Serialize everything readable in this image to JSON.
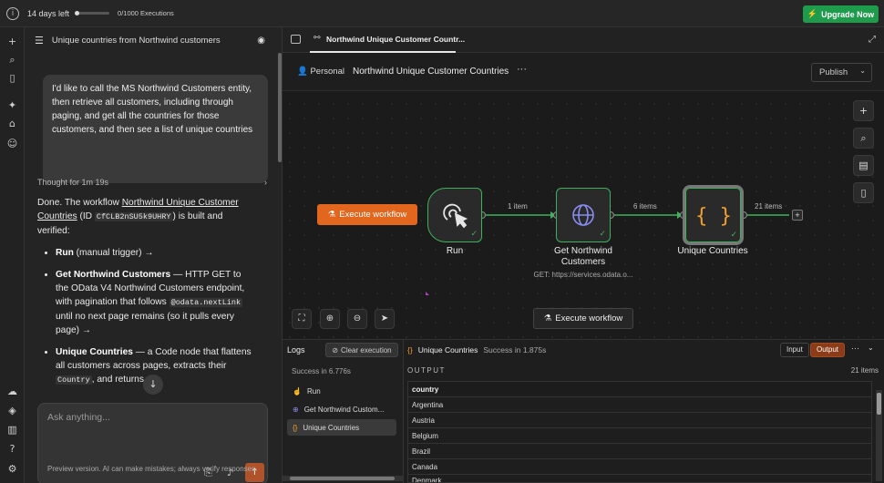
{
  "topbar": {
    "trial": "14 days left",
    "executions": "0/1000 Executions",
    "upgrade": "Upgrade Now",
    "upgrade_icon": "⚡"
  },
  "chat": {
    "title": "Unique countries from Northwind customers",
    "user_message": "I'd like to call the MS Northwind Customers entity, then retrieve all customers, including through paging, and get all the countries for those customers, and then see a list of unique countries",
    "thought": "Thought for 1m 19s",
    "reply_intro_1": "Done. The workflow ",
    "reply_link": "Northwind Unique Customer Countries",
    "reply_intro_2": " (ID ",
    "reply_id": "CfCLB2nSU5k9UHRY",
    "reply_intro_3": ") is built and verified:",
    "bullet1_bold": "Run",
    "bullet1_rest": " (manual trigger) →",
    "bullet2_bold": "Get Northwind Customers",
    "bullet2_rest": " — HTTP GET to the OData V4 Northwind Customers endpoint, with pagination that follows ",
    "bullet2_code": "@odata.nextLink",
    "bullet2_rest2": " until no next page remains (so it pulls every page) →",
    "bullet3_bold": "Unique Countries",
    "bullet3_rest": " — a Code node that flattens all customers across pages, extracts their ",
    "bullet3_code": "Country",
    "bullet3_rest2": ", and returns a",
    "input_placeholder": "Ask anything...",
    "disclaimer": "Preview version. AI can make mistakes; always verify responses."
  },
  "tab": {
    "label": "Northwind Unique Customer Countr..."
  },
  "workflow": {
    "owner": "Personal",
    "name": "Northwind Unique Customer Countries",
    "publish": "Publish",
    "execute": "Execute workflow"
  },
  "nodes": {
    "run": {
      "label": "Run"
    },
    "http": {
      "label1": "Get Northwind",
      "label2": "Customers",
      "sub": "GET: https://services.odata.o..."
    },
    "code": {
      "label": "Unique Countries"
    }
  },
  "edges": {
    "e1": "1 item",
    "e2": "6 items",
    "e3": "21 items"
  },
  "logs": {
    "title": "Logs",
    "clear": "Clear execution",
    "success": "Success in 6.776s",
    "items": [
      "Run",
      "Get Northwind Custom...",
      "Unique Countries"
    ]
  },
  "output": {
    "node": "Unique Countries",
    "status": "Success in 1.875s",
    "input_tab": "Input",
    "output_tab": "Output",
    "label": "OUTPUT",
    "count": "21 items",
    "column": "country",
    "rows": [
      "Argentina",
      "Austria",
      "Belgium",
      "Brazil",
      "Canada",
      "Denmark"
    ]
  },
  "colors": {
    "accent": "#e2661e",
    "success": "#3fb15a",
    "upgrade": "#1f9b4c"
  }
}
